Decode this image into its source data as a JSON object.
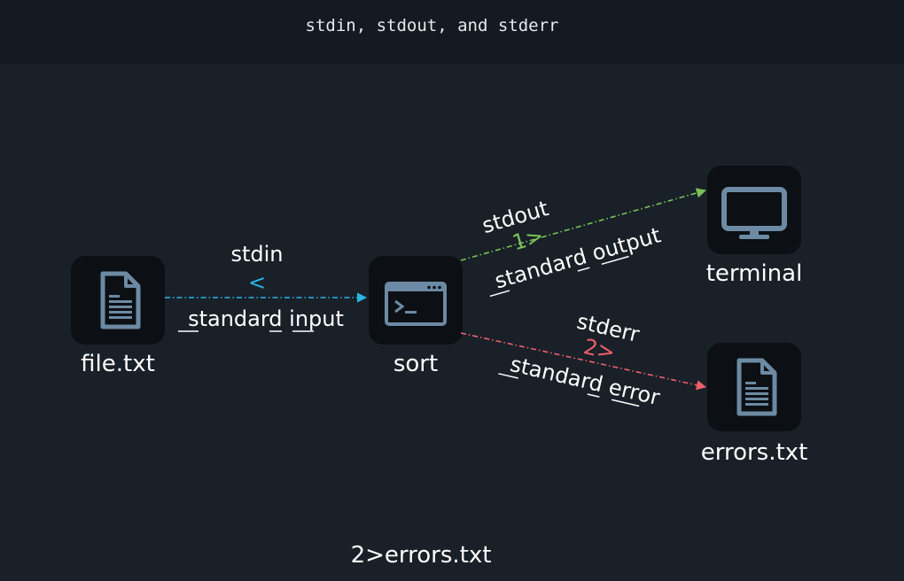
{
  "title": "stdin, stdout, and stderr",
  "nodes": {
    "file": {
      "label": "file.txt"
    },
    "sort": {
      "label": "sort"
    },
    "terminal": {
      "label": "terminal"
    },
    "errors": {
      "label": "errors.txt"
    }
  },
  "edges": {
    "stdin": {
      "name": "stdin",
      "op": "<",
      "desc": "standard input",
      "color": "#29b6e6"
    },
    "stdout": {
      "name": "stdout",
      "op": "1>",
      "desc": "standard output",
      "color": "#78c257"
    },
    "stderr": {
      "name": "stderr",
      "op": "2>",
      "desc": "standard error",
      "color": "#f0606b"
    }
  },
  "footer": "2>errors.txt",
  "icons": {
    "file": "document-icon",
    "sort": "terminal-window-icon",
    "terminal": "monitor-icon",
    "errors": "document-icon"
  }
}
